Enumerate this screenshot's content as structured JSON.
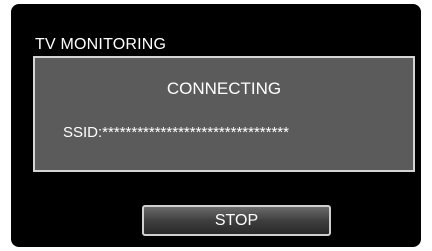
{
  "screen": {
    "title": "TV MONITORING"
  },
  "dialog": {
    "status": "CONNECTING",
    "ssid_text": "SSID:********************************"
  },
  "actions": {
    "stop_label": "STOP"
  }
}
